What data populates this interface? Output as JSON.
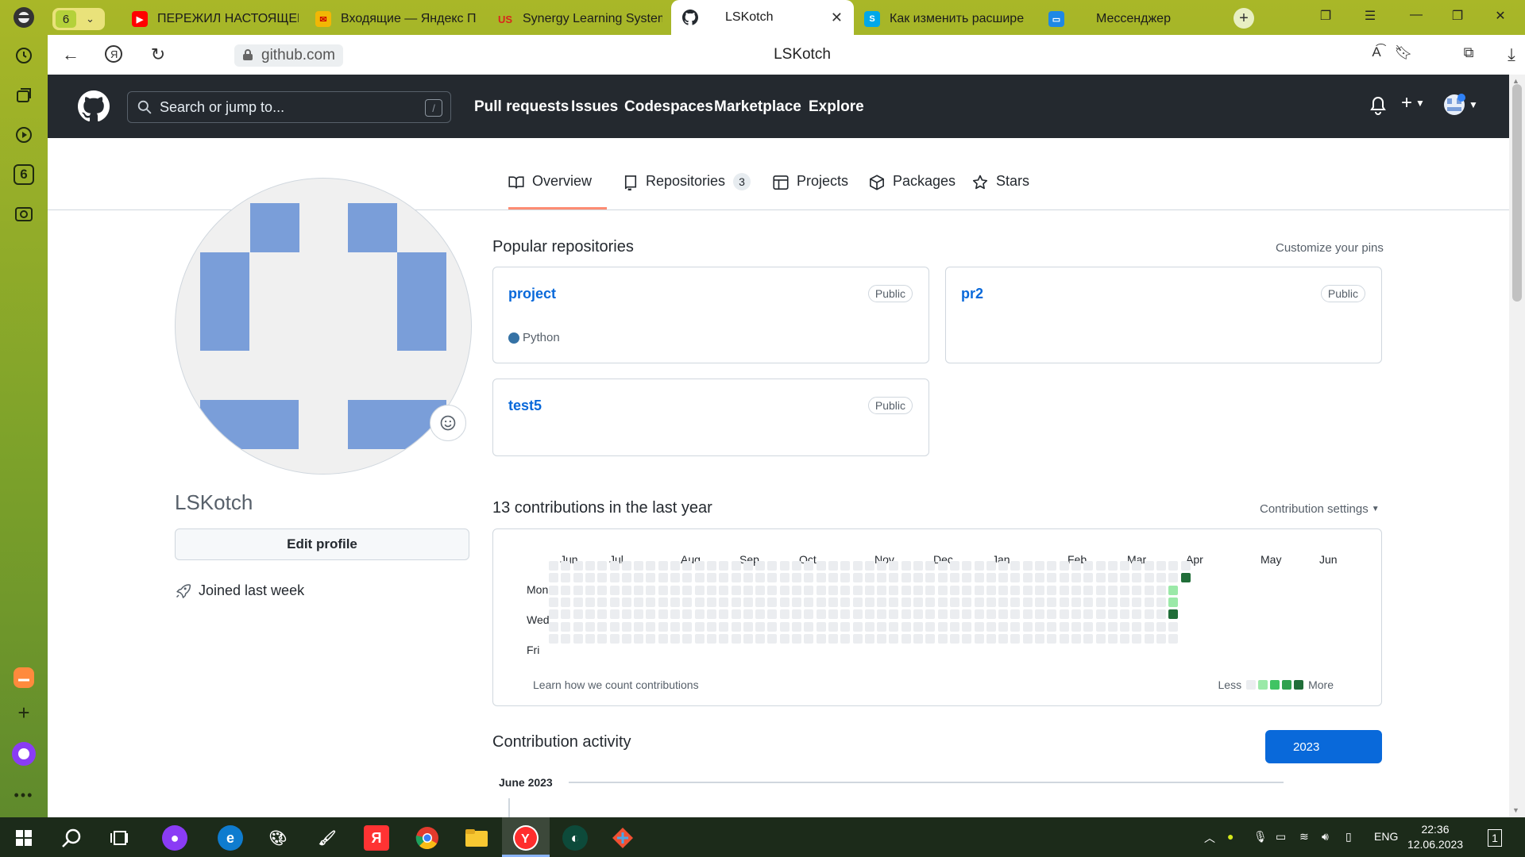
{
  "browser": {
    "tab_counter": "6",
    "tabs": [
      {
        "title": "ПЕРЕЖИЛ НАСТОЯЩЕЕ",
        "icon": "youtube-icon",
        "color": "#ff0000"
      },
      {
        "title": "Входящие — Яндекс П",
        "icon": "yandex-mail-icon",
        "color": "#f2b705"
      },
      {
        "title": "Synergy Learning System",
        "icon": "synergy-icon",
        "color": "#d9261c"
      },
      {
        "title": "LSKotch",
        "icon": "github-icon",
        "color": "#24292f"
      },
      {
        "title": "Как изменить расшире",
        "icon": "skype-icon",
        "color": "#00a8e8"
      },
      {
        "title": "Мессенджер",
        "icon": "messenger-icon",
        "color": "#1e88e5"
      }
    ],
    "url": "github.com",
    "page_title": "LSKotch"
  },
  "header": {
    "search_placeholder": "Search or jump to...",
    "search_shortcut": "/",
    "nav": [
      "Pull requests",
      "Issues",
      "Codespaces",
      "Marketplace",
      "Explore"
    ]
  },
  "profile_tabs": [
    {
      "label": "Overview",
      "icon": "book-icon"
    },
    {
      "label": "Repositories",
      "icon": "repo-icon",
      "count": "3"
    },
    {
      "label": "Projects",
      "icon": "table-icon"
    },
    {
      "label": "Packages",
      "icon": "package-icon"
    },
    {
      "label": "Stars",
      "icon": "star-icon"
    }
  ],
  "profile": {
    "username": "LSKotch",
    "edit_label": "Edit profile",
    "joined": "Joined last week"
  },
  "popular": {
    "title": "Popular repositories",
    "customize": "Customize your pins",
    "repos": [
      {
        "name": "project",
        "visibility": "Public",
        "language": "Python"
      },
      {
        "name": "pr2",
        "visibility": "Public",
        "language": ""
      },
      {
        "name": "test5",
        "visibility": "Public",
        "language": ""
      }
    ]
  },
  "contributions": {
    "title": "13 contributions in the last year",
    "settings": "Contribution settings",
    "months": [
      "Jun",
      "Jul",
      "Aug",
      "Sep",
      "Oct",
      "Nov",
      "Dec",
      "Jan",
      "Feb",
      "Mar",
      "Apr",
      "May",
      "Jun"
    ],
    "days": [
      "Mon",
      "Wed",
      "Fri"
    ],
    "learn": "Learn how we count contributions",
    "less": "Less",
    "more": "More",
    "colors": [
      "#ebedf0",
      "#9be9a8",
      "#40c463",
      "#30a14e",
      "#216e39"
    ]
  },
  "activity": {
    "title": "Contribution activity",
    "year": "2023",
    "period": "June 2023"
  },
  "taskbar": {
    "lang": "ENG",
    "time": "22:36",
    "date": "12.06.2023",
    "notifications": "1"
  }
}
